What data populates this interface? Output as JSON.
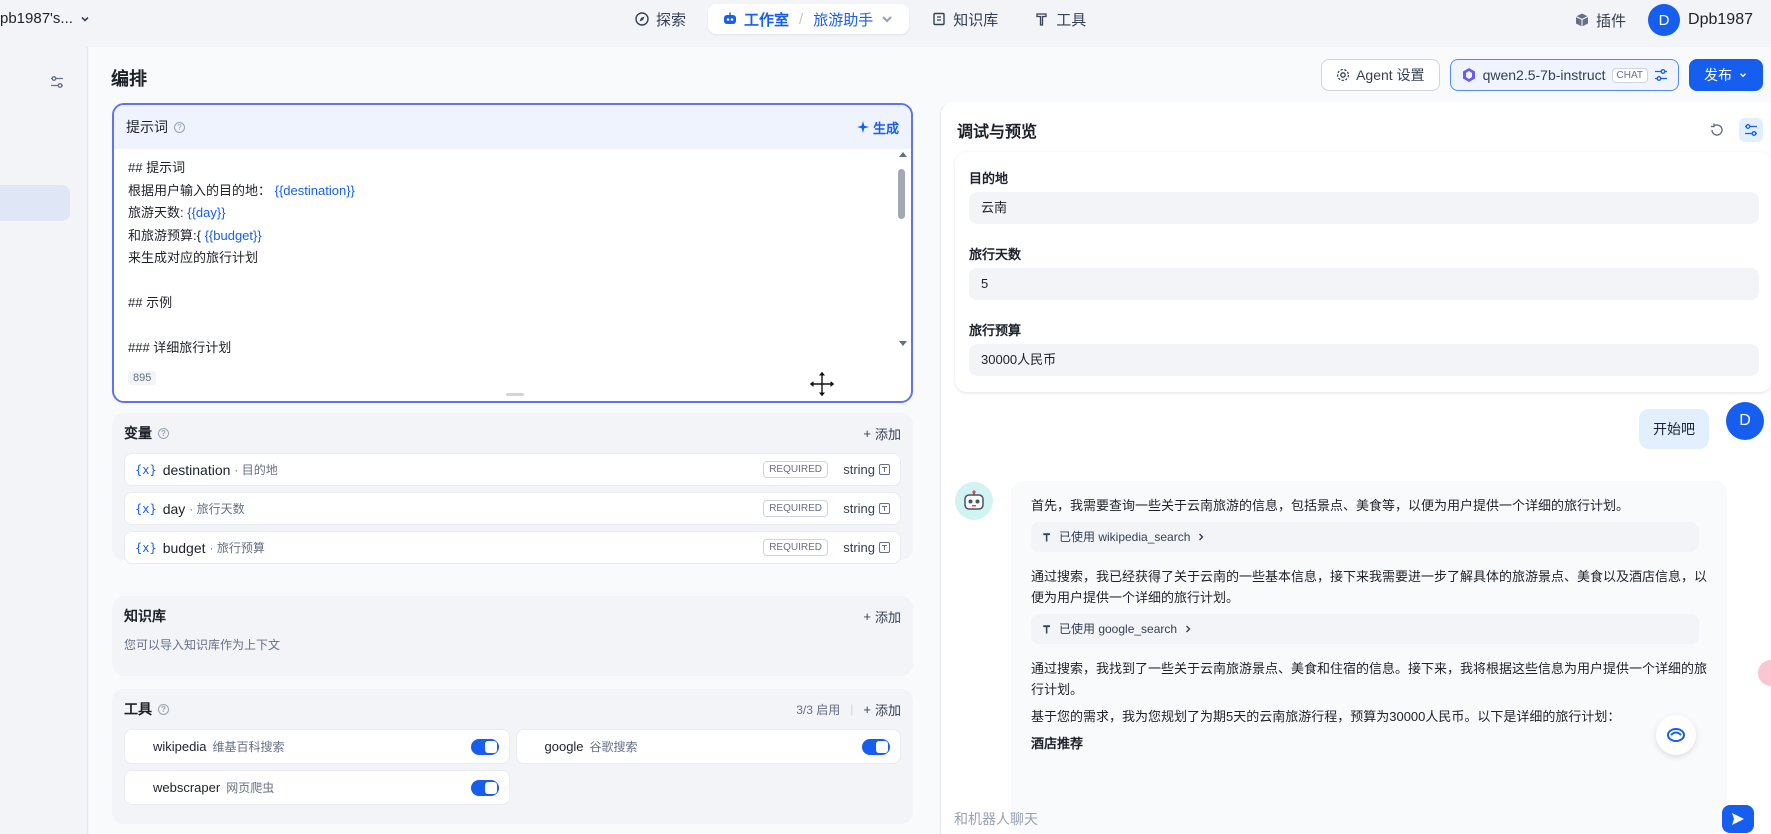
{
  "topbar": {
    "workspace": "pb1987's...",
    "nav": {
      "explore": "探索",
      "studio": "工作室",
      "app": "旅游助手",
      "knowledge": "知识库",
      "tools": "工具"
    },
    "plugin": "插件",
    "user_initial": "D",
    "user_name": "Dpb1987"
  },
  "main": {
    "title": "编排",
    "agent_settings": "Agent 设置",
    "model": "qwen2.5-7b-instruct",
    "model_tag": "CHAT",
    "publish": "发布"
  },
  "prompt": {
    "title": "提示词",
    "generate": "生成",
    "lines": [
      {
        "pre": "## 提示词",
        "var": "",
        "post": ""
      },
      {
        "pre": "根据用户输入的目的地： ",
        "var": "{{destination}}",
        "post": ""
      },
      {
        "pre": "旅游天数: ",
        "var": "{{day}}",
        "post": ""
      },
      {
        "pre": "和旅游预算:{ ",
        "var": "{{budget}}",
        "post": ""
      },
      {
        "pre": "来生成对应的旅行计划",
        "var": "",
        "post": ""
      },
      {
        "pre": "",
        "var": "",
        "post": ""
      },
      {
        "pre": "## 示例",
        "var": "",
        "post": ""
      },
      {
        "pre": "",
        "var": "",
        "post": ""
      },
      {
        "pre": "### 详细旅行计划",
        "var": "",
        "post": ""
      }
    ],
    "char_count": "895"
  },
  "variables": {
    "title": "变量",
    "add": "添加",
    "items": [
      {
        "key": "destination",
        "label": "目的地",
        "required": "REQUIRED",
        "type": "string"
      },
      {
        "key": "day",
        "label": "旅行天数",
        "required": "REQUIRED",
        "type": "string"
      },
      {
        "key": "budget",
        "label": "旅行预算",
        "required": "REQUIRED",
        "type": "string"
      }
    ]
  },
  "knowledge": {
    "title": "知识库",
    "add": "添加",
    "hint": "您可以导入知识库作为上下文"
  },
  "tools": {
    "title": "工具",
    "enabled": "3/3 启用",
    "add": "添加",
    "items": [
      {
        "name": "wikipedia",
        "desc": "维基百科搜索"
      },
      {
        "name": "google",
        "desc": "谷歌搜索"
      },
      {
        "name": "webscraper",
        "desc": "网页爬虫"
      }
    ]
  },
  "debug": {
    "title": "调试与预览",
    "fields": [
      {
        "label": "目的地",
        "value": "云南"
      },
      {
        "label": "旅行天数",
        "value": "5"
      },
      {
        "label": "旅行预算",
        "value": "30000人民币"
      }
    ],
    "user_message": "开始吧",
    "user_initial": "D",
    "answer": {
      "p1": "首先，我需要查询一些关于云南旅游的信息，包括景点、美食等，以便为用户提供一个详细的旅行计划。",
      "tool1": "已使用 wikipedia_search",
      "p2": "通过搜索，我已经获得了关于云南的一些基本信息，接下来我需要进一步了解具体的旅游景点、美食以及酒店信息，以便为用户提供一个详细的旅行计划。",
      "tool2": "已使用 google_search",
      "p3": "通过搜索，我找到了一些关于云南旅游景点、美食和住宿的信息。接下来，我将根据这些信息为用户提供一个详细的旅行计划。",
      "p4": "基于您的需求，我为您规划了为期5天的云南旅游行程，预算为30000人民币。以下是详细的旅行计划：",
      "p5": "酒店推荐"
    },
    "chat_placeholder": "和机器人聊天"
  }
}
